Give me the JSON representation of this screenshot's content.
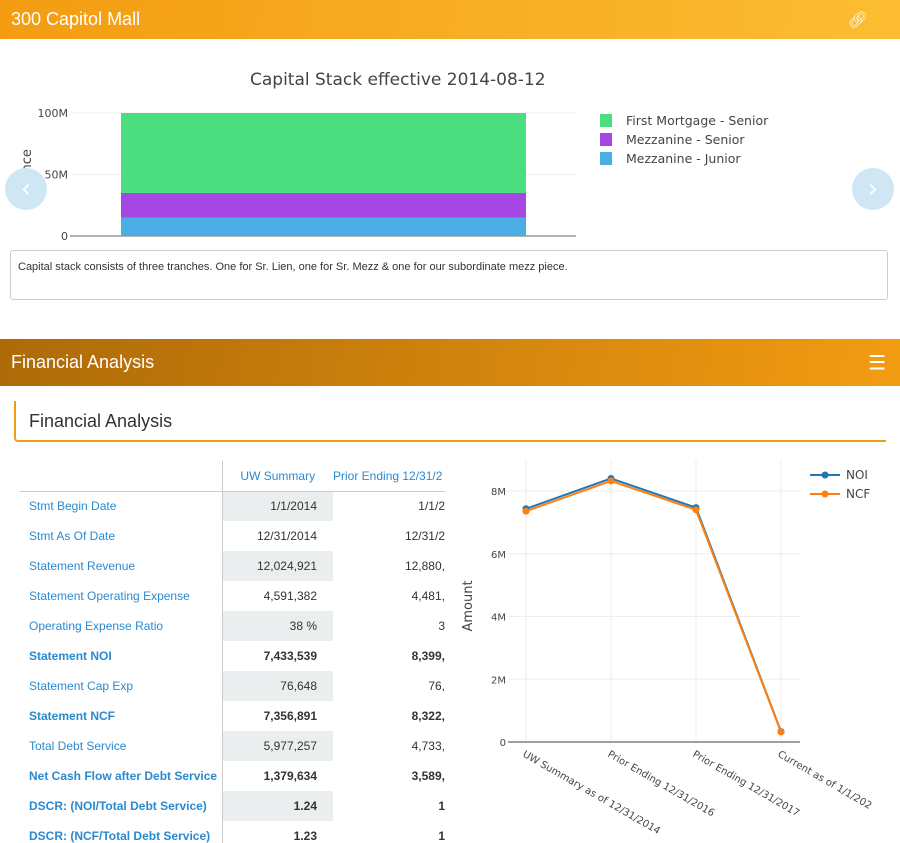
{
  "header": {
    "title": "300 Capitol Mall",
    "icon": "link-icon"
  },
  "capital_stack": {
    "note": "Capital stack consists of three tranches. One for Sr. Lien, one for Sr. Mezz & one for our subordinate mezz piece.",
    "prev_icon": "chevron-left-icon",
    "next_icon": "chevron-right-icon"
  },
  "financial": {
    "header_title": "Financial Analysis",
    "menu_icon": "hamburger-icon",
    "section_title": "Financial Analysis",
    "table": {
      "columns": [
        "",
        "UW Summary",
        "Prior Ending 12/31/2"
      ],
      "rows": [
        {
          "label": "Stmt Begin Date",
          "uw": "1/1/2014",
          "prior": "1/1/2",
          "bold": false
        },
        {
          "label": "Stmt As Of Date",
          "uw": "12/31/2014",
          "prior": "12/31/2",
          "bold": false
        },
        {
          "label": "Statement Revenue",
          "uw": "12,024,921",
          "prior": "12,880,",
          "bold": false
        },
        {
          "label": "Statement Operating Expense",
          "uw": "4,591,382",
          "prior": "4,481,",
          "bold": false
        },
        {
          "label": "Operating Expense Ratio",
          "uw": "38 %",
          "prior": "3",
          "bold": false
        },
        {
          "label": "Statement NOI",
          "uw": "7,433,539",
          "prior": "8,399,",
          "bold": true
        },
        {
          "label": "Statement Cap Exp",
          "uw": "76,648",
          "prior": "76,",
          "bold": false
        },
        {
          "label": "Statement NCF",
          "uw": "7,356,891",
          "prior": "8,322,",
          "bold": true
        },
        {
          "label": "Total Debt Service",
          "uw": "5,977,257",
          "prior": "4,733,",
          "bold": false
        },
        {
          "label": "Net Cash Flow after Debt Service",
          "uw": "1,379,634",
          "prior": "3,589,",
          "bold": true
        },
        {
          "label": "DSCR: (NOI/Total Debt Service)",
          "uw": "1.24",
          "prior": "1",
          "bold": true
        },
        {
          "label": "DSCR: (NCF/Total Debt Service)",
          "uw": "1.23",
          "prior": "1",
          "bold": true
        }
      ]
    }
  },
  "chart_data": [
    {
      "type": "bar",
      "stacked": true,
      "title": "Capital Stack effective 2014-08-12",
      "ylabel": "Balance",
      "ylim": [
        0,
        100000000
      ],
      "yticks": [
        {
          "v": 0,
          "label": "0"
        },
        {
          "v": 50000000,
          "label": "50M"
        },
        {
          "v": 100000000,
          "label": "100M"
        }
      ],
      "legend": "right",
      "series": [
        {
          "name": "Mezzanine - Junior",
          "value": 15000000,
          "color": "#4aaee5"
        },
        {
          "name": "Mezzanine - Senior",
          "value": 20000000,
          "color": "#a546e5"
        },
        {
          "name": "First Mortgage - Senior",
          "value": 65000000,
          "color": "#4ade80"
        }
      ]
    },
    {
      "type": "line",
      "ylabel": "Amount",
      "ylim": [
        0,
        8800000
      ],
      "legend": "top-right",
      "grid": true,
      "categories": [
        "UW Summary as of 12/31/2014",
        "Prior Ending 12/31/2016",
        "Prior Ending 12/31/2017",
        "Current as of 1/1/202"
      ],
      "yticks": [
        {
          "v": 0,
          "label": "0"
        },
        {
          "v": 2000000,
          "label": "2M"
        },
        {
          "v": 4000000,
          "label": "4M"
        },
        {
          "v": 6000000,
          "label": "6M"
        },
        {
          "v": 8000000,
          "label": "8M"
        }
      ],
      "series": [
        {
          "name": "NOI",
          "color": "#1f77b4",
          "values": [
            7433539,
            8399000,
            7470000,
            330000
          ]
        },
        {
          "name": "NCF",
          "color": "#ff7f0e",
          "values": [
            7356891,
            8322000,
            7400000,
            320000
          ]
        }
      ]
    }
  ]
}
